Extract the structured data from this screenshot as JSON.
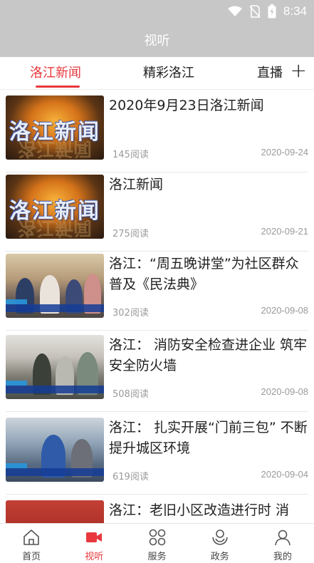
{
  "status_bar": {
    "time": "8:34",
    "icons": [
      "wifi-icon",
      "no-sim-icon",
      "battery-icon"
    ]
  },
  "header": {
    "title": "视听"
  },
  "tabs": [
    {
      "label": "洛江新闻",
      "active": true
    },
    {
      "label": "精彩洛江",
      "active": false
    },
    {
      "label": "直播",
      "active": false
    }
  ],
  "add_label": "+",
  "items": [
    {
      "title": "2020年9月23日洛江新闻",
      "reads": "145阅读",
      "date": "2020-09-24",
      "thumb_text": "洛江新闻"
    },
    {
      "title": "洛江新闻",
      "reads": "275阅读",
      "date": "2020-09-21",
      "thumb_text": "洛江新闻"
    },
    {
      "title": "洛江：“周五晚讲堂”为社区群众普及《民法典》",
      "reads": "302阅读",
      "date": "2020-09-08"
    },
    {
      "title": "洛江：  消防安全检查进企业 筑牢安全防火墙",
      "reads": "508阅读",
      "date": "2020-09-08"
    },
    {
      "title": "洛江：  扎实开展“门前三包” 不断提升城区环境",
      "reads": "619阅读",
      "date": "2020-09-04"
    },
    {
      "title": "洛江：老旧小区改造进行时 消防…",
      "reads": "",
      "date": ""
    }
  ],
  "bottom_nav": [
    {
      "label": "首页",
      "icon": "home-icon",
      "active": false
    },
    {
      "label": "视听",
      "icon": "video-icon",
      "active": true
    },
    {
      "label": "服务",
      "icon": "grid-icon",
      "active": false
    },
    {
      "label": "政务",
      "icon": "hands-icon",
      "active": false
    },
    {
      "label": "我的",
      "icon": "user-icon",
      "active": false
    }
  ],
  "colors": {
    "accent": "#e8383d",
    "header_bg": "#c7c7c7"
  }
}
